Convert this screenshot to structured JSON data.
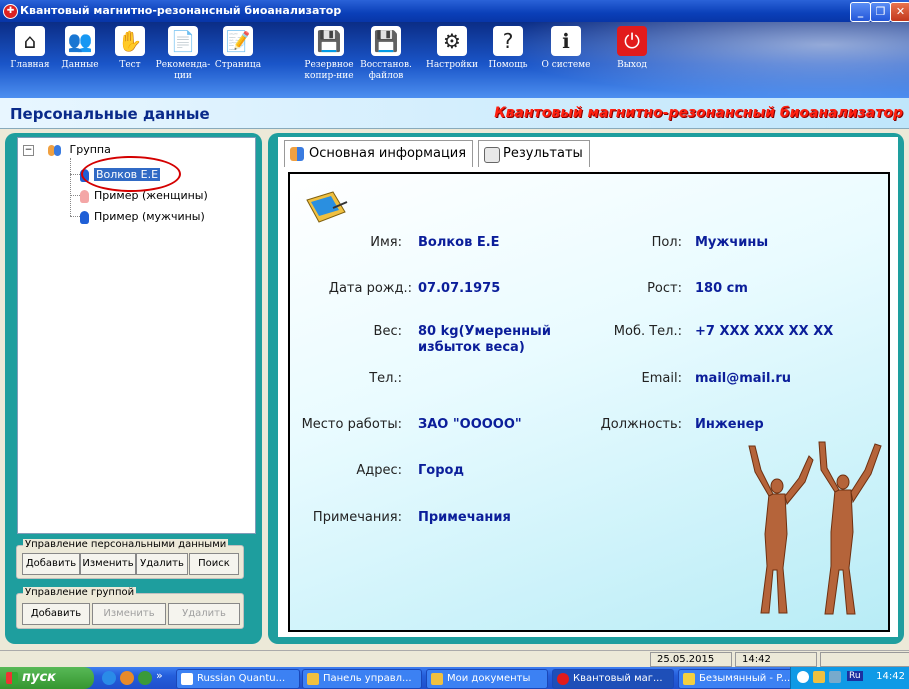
{
  "window": {
    "title": "Квантовый магнитно-резонансный биоанализатор"
  },
  "toolbar": {
    "items": [
      {
        "label": "Главная",
        "icon": "house-icon"
      },
      {
        "label": "Данные",
        "icon": "users-icon"
      },
      {
        "label": "Тест",
        "icon": "hand-icon"
      },
      {
        "label": "Рекоменда-ции",
        "icon": "document-icon"
      },
      {
        "label": "Страница",
        "icon": "notepad-icon"
      },
      {
        "label": "Резервное копир-ние",
        "icon": "save-icon"
      },
      {
        "label": "Восстанов. файлов",
        "icon": "restore-icon"
      },
      {
        "label": "Настройки",
        "icon": "gears-icon"
      },
      {
        "label": "Помощь",
        "icon": "help-icon"
      },
      {
        "label": "О системе",
        "icon": "info-icon"
      },
      {
        "label": "Выход",
        "icon": "exit-icon"
      }
    ]
  },
  "header": {
    "section_title": "Персональные данные",
    "brand_title": "Квантовый магнитно-резонансный биоанализатор"
  },
  "tree": {
    "group_label": "Группа",
    "items": [
      {
        "label": "Волков Е.Е",
        "gender": "male",
        "selected": true
      },
      {
        "label": "Пример (женщины)",
        "gender": "female",
        "selected": false
      },
      {
        "label": "Пример (мужчины)",
        "gender": "male",
        "selected": false
      }
    ]
  },
  "personal_mgmt": {
    "legend": "Управление персональными данными",
    "add": "Добавить",
    "edit": "Изменить",
    "delete": "Удалить",
    "search": "Поиск"
  },
  "group_mgmt": {
    "legend": "Управление группой",
    "add": "Добавить",
    "edit": "Изменить",
    "delete": "Удалить"
  },
  "tabs": [
    {
      "label": "Основная информация",
      "active": true
    },
    {
      "label": "Результаты",
      "active": false
    }
  ],
  "profile": {
    "name_label": "Имя:",
    "name": "Волков Е.Е",
    "gender_label": "Пол:",
    "gender": "Мужчины",
    "dob_label": "Дата рожд.:",
    "dob": "07.07.1975",
    "height_label": "Рост:",
    "height": "180 cm",
    "weight_label": "Вес:",
    "weight": "80 kg(Умеренный избыток веса)",
    "mobile_label": "Моб. Тел.:",
    "mobile": "+7 XXX XXX XX XX",
    "phone_label": "Тел.:",
    "phone": "",
    "email_label": "Email:",
    "email": "mail@mail.ru",
    "workplace_label": "Место работы:",
    "workplace": "ЗАО \"ООООО\"",
    "position_label": "Должность:",
    "position": "Инженер",
    "address_label": "Адрес:",
    "address": "Город",
    "notes_label": "Примечания:",
    "notes": "Примечания"
  },
  "statusbar": {
    "date": "25.05.2015",
    "time": "14:42"
  },
  "taskbar": {
    "start": "пуск",
    "tasks": [
      {
        "label": "Russian Quantu...",
        "active": false
      },
      {
        "label": "Панель управл...",
        "active": false
      },
      {
        "label": "Мои документы",
        "active": false
      },
      {
        "label": "Квантовый маг...",
        "active": true
      },
      {
        "label": "Безымянный - P...",
        "active": false
      }
    ],
    "lang": "Ru",
    "clock": "14:42"
  }
}
